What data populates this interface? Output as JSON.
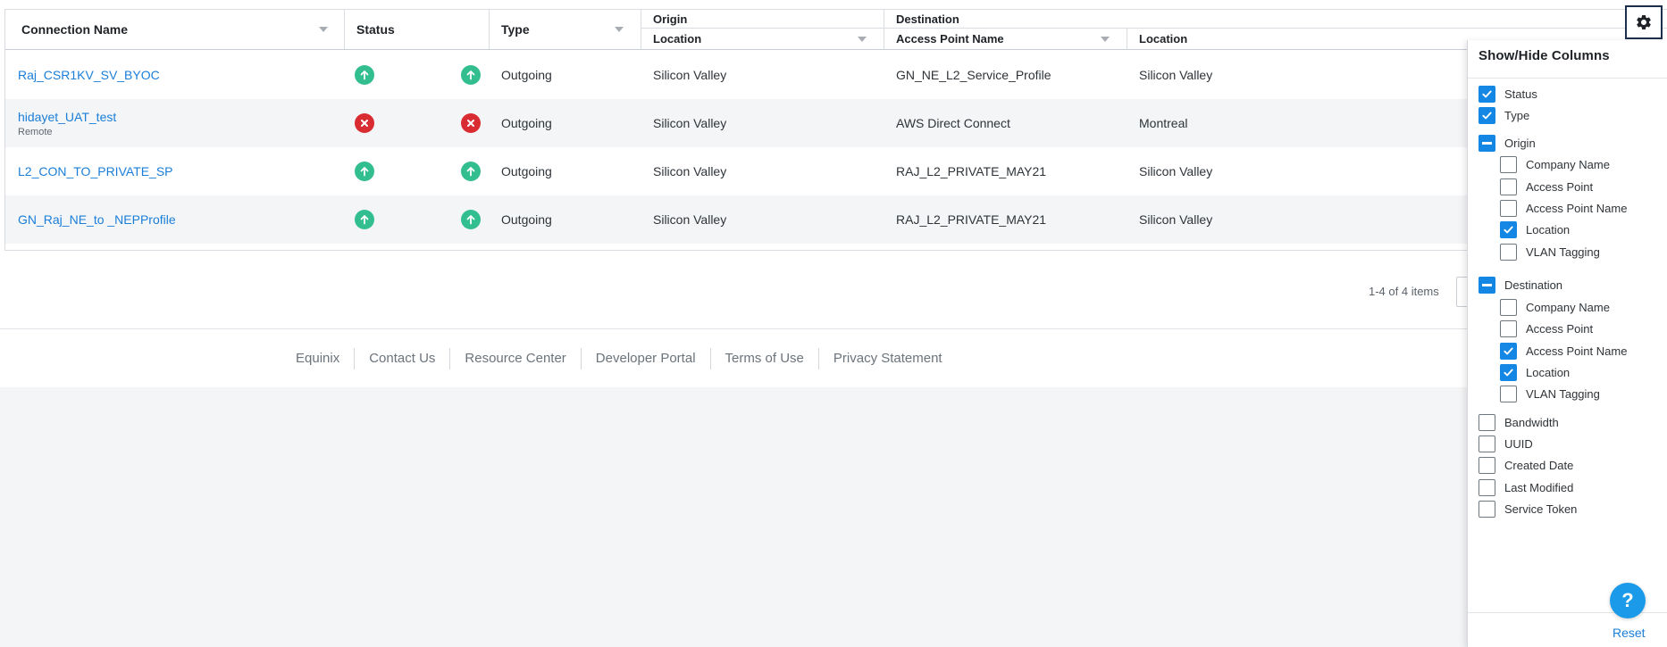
{
  "grid": {
    "headers": {
      "connection_name": "Connection Name",
      "status": "Status",
      "type": "Type",
      "origin": "Origin",
      "origin_location": "Location",
      "destination": "Destination",
      "dest_access_point_name": "Access Point Name",
      "dest_location": "Location"
    },
    "rows": [
      {
        "name": "Raj_CSR1KV_SV_BYOC",
        "sub": "",
        "status": "up",
        "type": "Outgoing",
        "origin_location": "Silicon Valley",
        "access_point_name": "GN_NE_L2_Service_Profile",
        "dest_location": "Silicon Valley"
      },
      {
        "name": "hidayet_UAT_test",
        "sub": "Remote",
        "status": "down",
        "type": "Outgoing",
        "origin_location": "Silicon Valley",
        "access_point_name": "AWS Direct Connect",
        "dest_location": "Montreal"
      },
      {
        "name": "L2_CON_TO_PRIVATE_SP",
        "sub": "",
        "status": "up",
        "type": "Outgoing",
        "origin_location": "Silicon Valley",
        "access_point_name": "RAJ_L2_PRIVATE_MAY21",
        "dest_location": "Silicon Valley"
      },
      {
        "name": "GN_Raj_NE_to _NEPProfile",
        "sub": "",
        "status": "up",
        "type": "Outgoing",
        "origin_location": "Silicon Valley",
        "access_point_name": "RAJ_L2_PRIVATE_MAY21",
        "dest_location": "Silicon Valley"
      }
    ]
  },
  "pager": {
    "summary": "1-4 of 4 items"
  },
  "footer": {
    "links": [
      "Equinix",
      "Contact Us",
      "Resource Center",
      "Developer Portal",
      "Terms of Use",
      "Privacy Statement"
    ]
  },
  "panel": {
    "title": "Show/Hide Columns",
    "options": [
      {
        "label": "Status",
        "state": "checked"
      },
      {
        "label": "Type",
        "state": "checked"
      },
      {
        "label": "Origin",
        "state": "partial"
      },
      {
        "label": "Company Name",
        "state": "unchecked"
      },
      {
        "label": "Access Point",
        "state": "unchecked"
      },
      {
        "label": "Access Point Name",
        "state": "unchecked"
      },
      {
        "label": "Location",
        "state": "checked"
      },
      {
        "label": "VLAN Tagging",
        "state": "unchecked"
      },
      {
        "label": "Destination",
        "state": "partial"
      },
      {
        "label": "Company Name",
        "state": "unchecked"
      },
      {
        "label": "Access Point",
        "state": "unchecked"
      },
      {
        "label": "Access Point Name",
        "state": "checked"
      },
      {
        "label": "Location",
        "state": "checked"
      },
      {
        "label": "VLAN Tagging",
        "state": "unchecked"
      },
      {
        "label": "Bandwidth",
        "state": "unchecked"
      },
      {
        "label": "UUID",
        "state": "unchecked"
      },
      {
        "label": "Created Date",
        "state": "unchecked"
      },
      {
        "label": "Last Modified",
        "state": "unchecked"
      },
      {
        "label": "Service Token",
        "state": "unchecked"
      }
    ],
    "reset_label": "Reset"
  },
  "help": {
    "label": "?"
  },
  "colors": {
    "accent": "#1387e3",
    "link": "#1a7ed8",
    "status_up": "#33be8f",
    "status_down": "#d92b32",
    "gear_border": "#1b2f4d"
  },
  "icons": {
    "gear": "gear-icon",
    "status_up": "arrow-up-icon",
    "status_down": "x-icon",
    "sort": "caret-down-icon"
  }
}
